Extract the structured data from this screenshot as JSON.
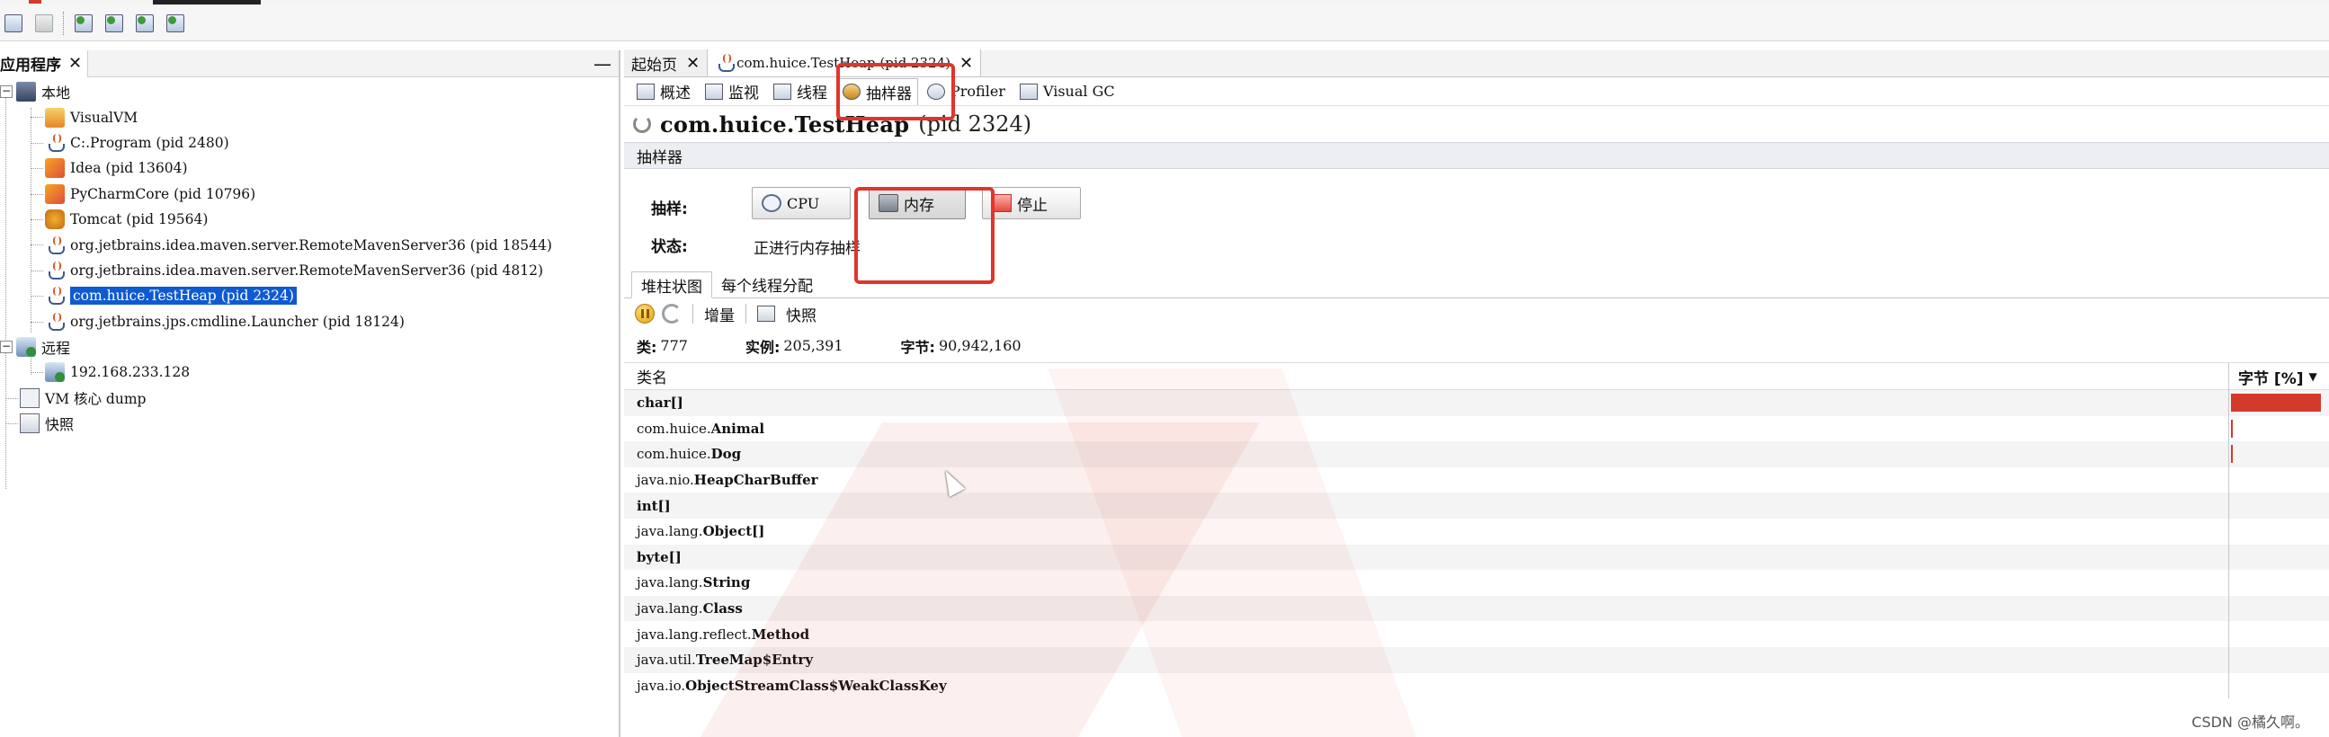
{
  "left_panel": {
    "tab_label": "应用程序",
    "close": "✕",
    "minimize": "—",
    "tree": {
      "local": "本地",
      "local_items": [
        {
          "label": "VisualVM",
          "icon": "visualvm-icon"
        },
        {
          "label": "C:.Program (pid 2480)",
          "icon": "java-icon"
        },
        {
          "label": "Idea (pid 13604)",
          "icon": "jetbrains-icon"
        },
        {
          "label": "PyCharmCore (pid 10796)",
          "icon": "jetbrains-icon"
        },
        {
          "label": "Tomcat (pid 19564)",
          "icon": "tomcat-icon"
        },
        {
          "label": "org.jetbrains.idea.maven.server.RemoteMavenServer36 (pid 18544)",
          "icon": "java-icon"
        },
        {
          "label": "org.jetbrains.idea.maven.server.RemoteMavenServer36 (pid 4812)",
          "icon": "java-icon"
        },
        {
          "label": "com.huice.TestHeap (pid 2324)",
          "icon": "java-icon",
          "selected": true
        },
        {
          "label": "org.jetbrains.jps.cmdline.Launcher (pid 18124)",
          "icon": "java-icon"
        }
      ],
      "remote": "远程",
      "remote_items": [
        {
          "label": "192.168.233.128",
          "icon": "remote-host-icon"
        }
      ],
      "core_dump": "VM 核心 dump",
      "snapshots": "快照"
    }
  },
  "tabs": {
    "start": "起始页",
    "process": "com.huice.TestHeap (pid 2324)",
    "close": "✕"
  },
  "sub_tabs": [
    {
      "label": "概述",
      "icon": "overview-icon"
    },
    {
      "label": "监视",
      "icon": "monitor-icon"
    },
    {
      "label": "线程",
      "icon": "threads-icon"
    },
    {
      "label": "抽样器",
      "icon": "sampler-icon",
      "active": true
    },
    {
      "label": "Profiler",
      "icon": "profiler-icon"
    },
    {
      "label": "Visual GC",
      "icon": "visualgc-icon"
    }
  ],
  "process_title": {
    "name": "com.huice.TestHeap",
    "pid": "(pid 2324)"
  },
  "sampler": {
    "header": "抽样器",
    "sample_label": "抽样:",
    "cpu_button": "CPU",
    "memory_button": "内存",
    "stop_button": "停止",
    "status_label": "状态:",
    "status_value": "正进行内存抽样"
  },
  "view_tabs": {
    "histogram": "堆柱状图",
    "per_thread": "每个线程分配"
  },
  "tools": {
    "delta": "增量",
    "snapshot": "快照"
  },
  "stats": {
    "classes_label": "类:",
    "classes_value": "777",
    "instances_label": "实例:",
    "instances_value": "205,391",
    "bytes_label": "字节:",
    "bytes_value": "90,942,160"
  },
  "table": {
    "col_class": "类名",
    "col_bytes": "字节 [%]",
    "sort_icon": "▼",
    "rows": [
      {
        "pkg": "",
        "name": "char[]",
        "pct": 100
      },
      {
        "pkg": "com.huice.",
        "name": "Animal",
        "pct": 0.3
      },
      {
        "pkg": "com.huice.",
        "name": "Dog",
        "pct": 0.2
      },
      {
        "pkg": "java.nio.",
        "name": "HeapCharBuffer",
        "pct": 0
      },
      {
        "pkg": "",
        "name": "int[]",
        "pct": 0
      },
      {
        "pkg": "java.lang.",
        "name": "Object[]",
        "pct": 0
      },
      {
        "pkg": "",
        "name": "byte[]",
        "pct": 0
      },
      {
        "pkg": "java.lang.",
        "name": "String",
        "pct": 0
      },
      {
        "pkg": "java.lang.",
        "name": "Class",
        "pct": 0
      },
      {
        "pkg": "java.lang.reflect.",
        "name": "Method",
        "pct": 0
      },
      {
        "pkg": "java.util.",
        "name": "TreeMap$Entry",
        "pct": 0
      },
      {
        "pkg": "java.io.",
        "name": "ObjectStreamClass$WeakClassKey",
        "pct": 0
      }
    ]
  },
  "credit": "CSDN @橘久啊。",
  "colors": {
    "selection": "#0f5ad1",
    "highlight_box": "#e0352b",
    "bar": "#d43a2c"
  }
}
